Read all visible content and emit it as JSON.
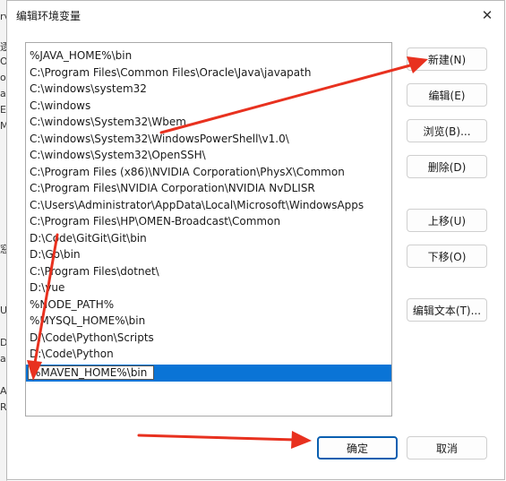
{
  "background": {
    "fragments": [
      "rv",
      "逐",
      "O",
      "on",
      "at",
      "EN",
      "M",
      "窓",
      "U",
      "DS",
      "at",
      "AL",
      "R"
    ]
  },
  "dialog": {
    "title": "编辑环境变量",
    "close_glyph": "✕"
  },
  "path_list": {
    "items": [
      "%JAVA_HOME%\\bin",
      "C:\\Program Files\\Common Files\\Oracle\\Java\\javapath",
      "C:\\windows\\system32",
      "C:\\windows",
      "C:\\windows\\System32\\Wbem",
      "C:\\windows\\System32\\WindowsPowerShell\\v1.0\\",
      "C:\\windows\\System32\\OpenSSH\\",
      "C:\\Program Files (x86)\\NVIDIA Corporation\\PhysX\\Common",
      "C:\\Program Files\\NVIDIA Corporation\\NVIDIA NvDLISR",
      "C:\\Users\\Administrator\\AppData\\Local\\Microsoft\\WindowsApps",
      "C:\\Program Files\\HP\\OMEN-Broadcast\\Common",
      "D:\\Code\\GitGit\\Git\\bin",
      "D:\\Go\\bin",
      "C:\\Program Files\\dotnet\\",
      "D:\\vue",
      "%NODE_PATH%",
      "%MYSQL_HOME%\\bin",
      "D:\\Code\\Python\\Scripts",
      "D:\\Code\\Python"
    ],
    "editing_value": "%MAVEN_HOME%\\bin"
  },
  "buttons": {
    "new": "新建(N)",
    "edit": "编辑(E)",
    "browse": "浏览(B)...",
    "delete": "删除(D)",
    "move_up": "上移(U)",
    "move_down": "下移(O)",
    "edit_text": "编辑文本(T)...",
    "ok": "确定",
    "cancel": "取消"
  },
  "colors": {
    "selection": "#0a74d6",
    "annotation_arrow": "#e8311f",
    "default_button_border": "#0a5fb0"
  }
}
